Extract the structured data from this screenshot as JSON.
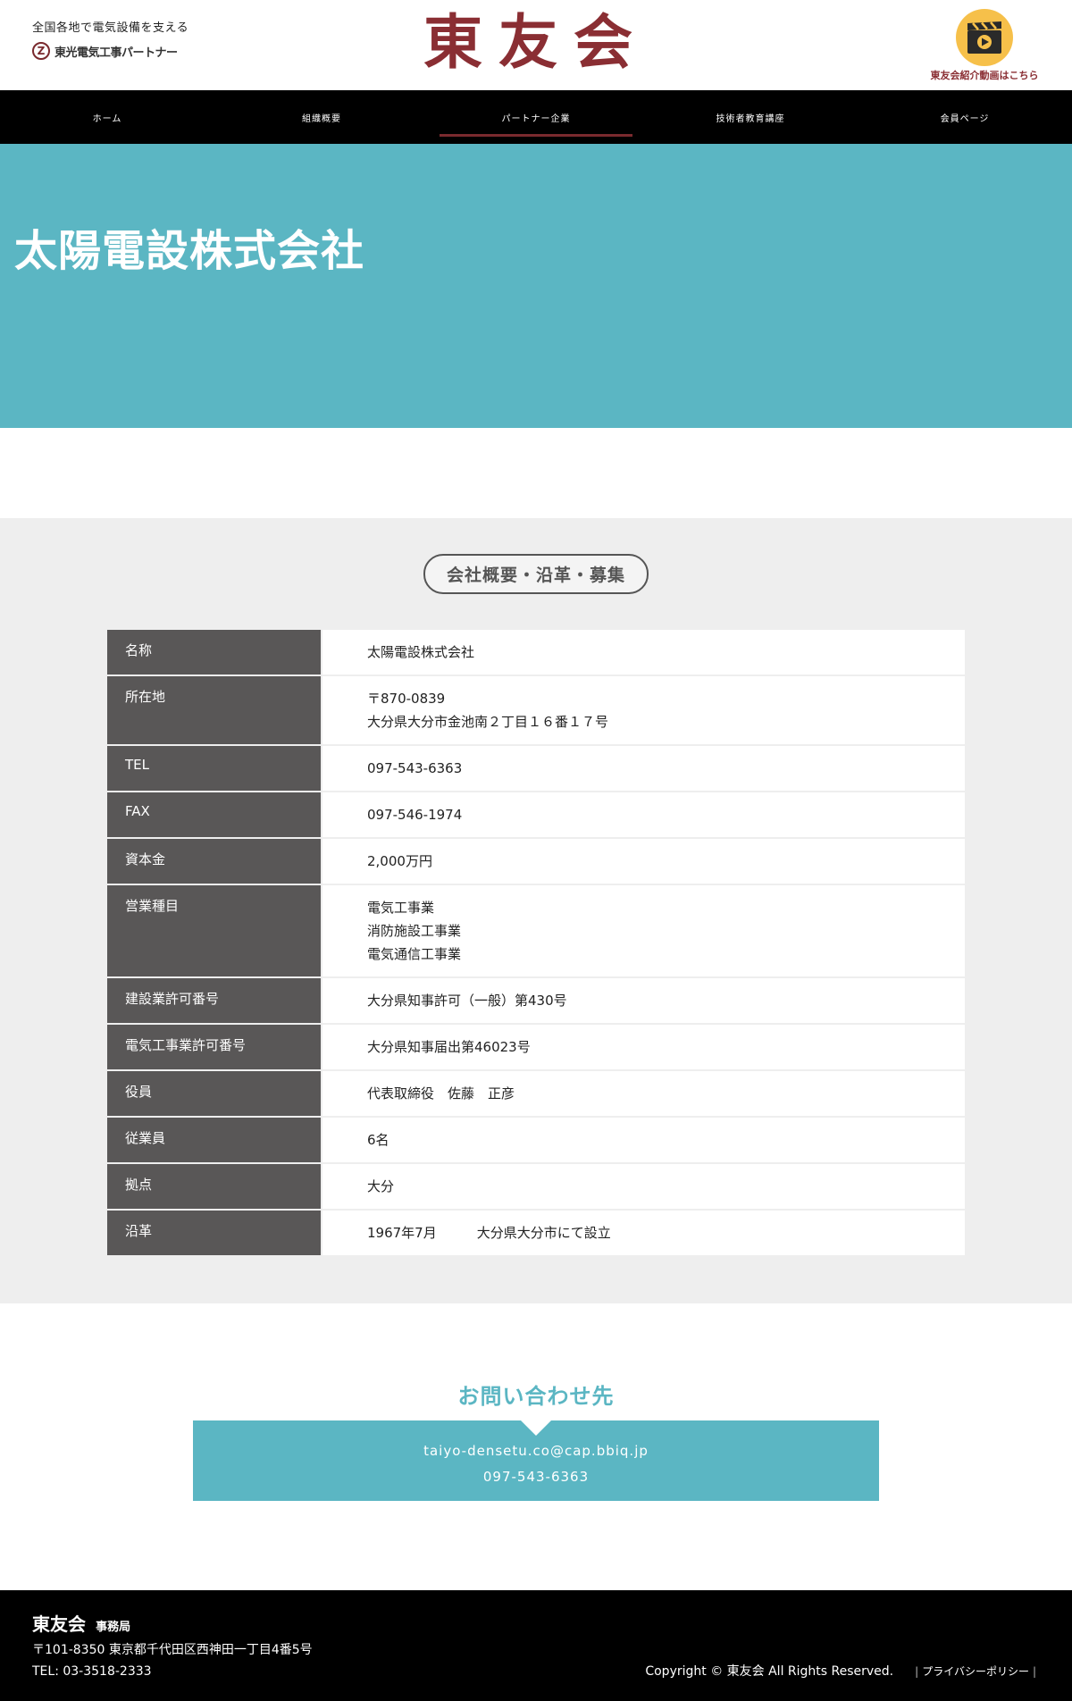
{
  "header": {
    "tagline": "全国各地で電気設備を支える",
    "partner_mark": "Z",
    "partner_text": "東光電気工事パートナー",
    "logo": "東友会",
    "video_label": "東友会紹介動画はこちら"
  },
  "nav": {
    "items": [
      {
        "label": "ホーム"
      },
      {
        "label": "組織概要"
      },
      {
        "label": "パートナー企業"
      },
      {
        "label": "技術者教育講座"
      },
      {
        "label": "会員ページ"
      }
    ],
    "active_index": 2,
    "accent_color": "#7a2a2e"
  },
  "hero": {
    "title": "太陽電設株式会社",
    "bg_color": "#5bb6c3"
  },
  "company": {
    "heading": "会社概要・沿革・募集",
    "rows": [
      {
        "label": "名称",
        "lines": [
          "太陽電設株式会社"
        ]
      },
      {
        "label": "所在地",
        "lines": [
          "〒870-0839",
          "大分県大分市金池南２丁目１６番１７号"
        ]
      },
      {
        "label": "TEL",
        "lines": [
          "097-543-6363"
        ]
      },
      {
        "label": "FAX",
        "lines": [
          "097-546-1974"
        ]
      },
      {
        "label": "資本金",
        "lines": [
          "2,000万円"
        ]
      },
      {
        "label": "営業種目",
        "lines": [
          "電気工事業",
          "消防施設工事業",
          "電気通信工事業"
        ]
      },
      {
        "label": "建設業許可番号",
        "lines": [
          "大分県知事許可（一般）第430号"
        ]
      },
      {
        "label": "電気工事業許可番号",
        "lines": [
          "大分県知事届出第46023号"
        ]
      },
      {
        "label": "役員",
        "lines": [
          "代表取締役　佐藤　正彦"
        ]
      },
      {
        "label": "従業員",
        "lines": [
          "6名"
        ]
      },
      {
        "label": "拠点",
        "lines": [
          "大分"
        ]
      },
      {
        "label": "沿革",
        "lines": [
          "1967年7月　　　大分県大分市にて設立"
        ]
      }
    ]
  },
  "contact": {
    "title": "お問い合わせ先",
    "email": "taiyo-densetu.co@cap.bbiq.jp",
    "phone": "097-543-6363"
  },
  "footer": {
    "org_name": "東友会",
    "office_label": "事務局",
    "address": "〒101-8350 東京都千代田区西神田一丁目4番5号",
    "tel": "TEL: 03-3518-2333",
    "copyright": "Copyright © 東友会 All Rights Reserved.",
    "privacy_link": "プライバシーポリシー",
    "separator": "|"
  },
  "colors": {
    "brand": "#8a2e33",
    "teal": "#5bb6c3",
    "table_header": "#595757",
    "video_icon_bg": "#f6c04a"
  },
  "icons": {
    "video": "clapperboard-play-icon",
    "partner": "z-circle-logo-icon"
  }
}
